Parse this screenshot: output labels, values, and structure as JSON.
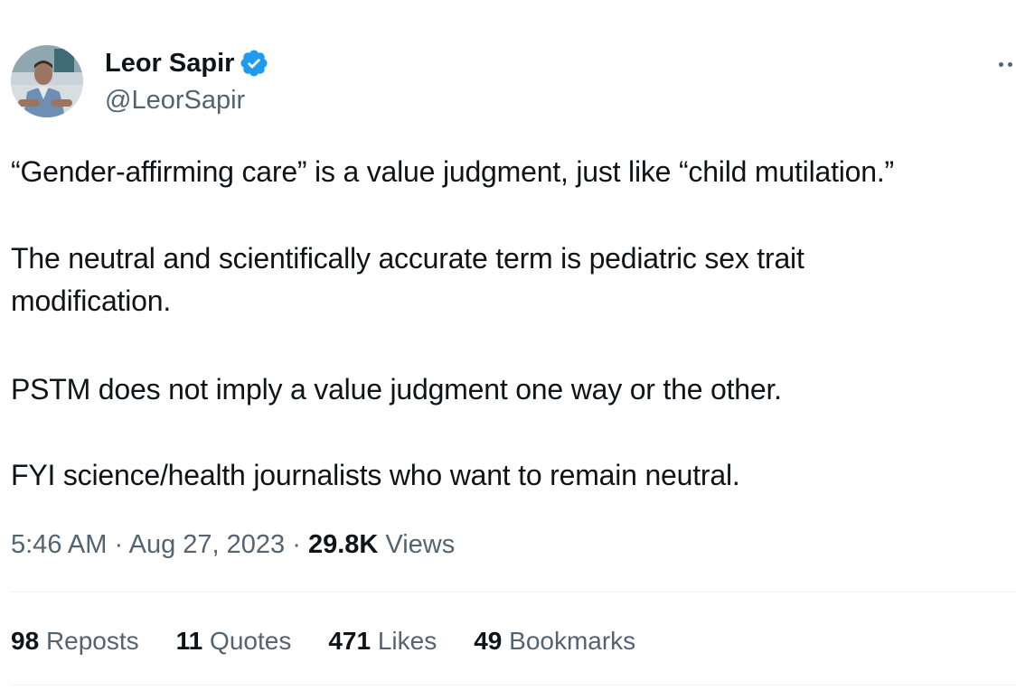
{
  "author": {
    "display_name": "Leor Sapir",
    "handle": "@LeorSapir",
    "verified_color": "#1d9bf0"
  },
  "tweet": {
    "paragraphs": [
      [
        "“Gender-affirming care” is a value judgment, just like “child mutilation.”"
      ],
      [
        "The neutral and scientifically accurate term is pediatric sex trait",
        "modification."
      ],
      [
        "PSTM does not imply a value judgment one way or the other."
      ],
      [
        "FYI science/health journalists who want to remain neutral."
      ]
    ],
    "time": "5:46 AM",
    "date": "Aug 27, 2023",
    "separator": "·",
    "views_count": "29.8K",
    "views_label": "Views"
  },
  "stats": [
    {
      "count": "98",
      "label": "Reposts"
    },
    {
      "count": "11",
      "label": "Quotes"
    },
    {
      "count": "471",
      "label": "Likes"
    },
    {
      "count": "49",
      "label": "Bookmarks"
    }
  ],
  "icons": {
    "verified": "verified-badge-icon",
    "more": "more-options-icon"
  },
  "colors": {
    "text": "#0f1419",
    "secondary": "#536471",
    "divider": "#eff3f4",
    "accent": "#1d9bf0"
  }
}
